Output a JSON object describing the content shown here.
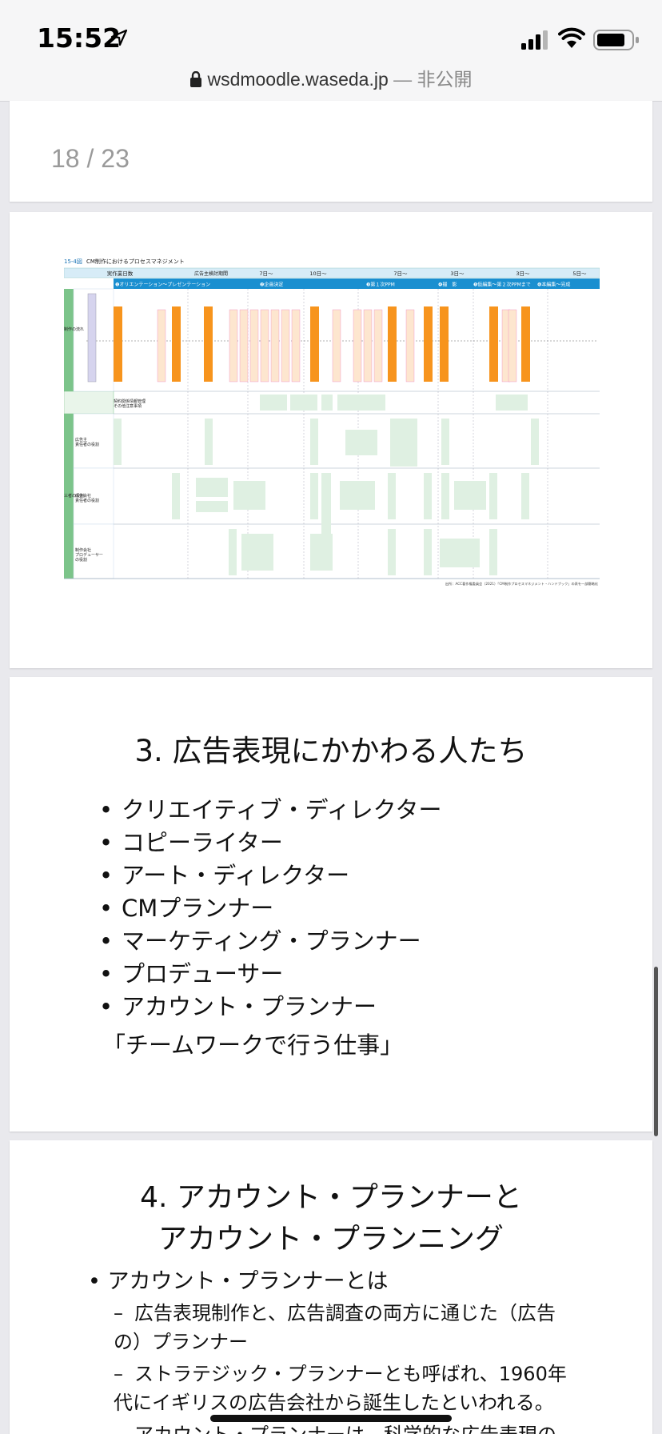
{
  "status": {
    "time": "15:52"
  },
  "address_bar": {
    "domain": "wsdmoodle.waseda.jp",
    "privacy": " — 非公開"
  },
  "page_counter": "18 / 23",
  "figure": {
    "label": "15-4図",
    "title": "CM制作におけるプロセスマネジメント",
    "headers": [
      "実作業日数",
      "広告主検討期間",
      "7日～",
      "10日～",
      "7日～",
      "3日～",
      "3日～",
      "5日～"
    ],
    "phases": [
      "❶オリエンテーション～プレゼンテーション",
      "❷企画決定",
      "❸第１次PPM",
      "❹撮　影",
      "❺仮編集～第２次PPMまで",
      "❻本編集～完成"
    ],
    "row_labels": [
      "契約関係情報管理\nその他注意事項",
      "広告主\n責任者の役割",
      "広告会社\n責任者の役割",
      "制作会社\nプロデューサー\nの役割"
    ],
    "side_labels": [
      "制作の流れ",
      "三者の役割"
    ],
    "source": "出所：ACC著作権委員会（2021）「CM制作プロセスマネジメント・ハンドブック」の表を一部簡略化"
  },
  "slide3": {
    "title": "3. 広告表現にかかわる人たち",
    "items": [
      "クリエイティブ・ディレクター",
      "コピーライター",
      "アート・ディレクター",
      "CMプランナー",
      "マーケティング・プランナー",
      "プロデューサー",
      "アカウント・プランナー"
    ],
    "tagline": "「チームワークで行う仕事」"
  },
  "slide4": {
    "title_line1": "4. アカウント・プランナーと",
    "title_line2": "アカウント・プランニング",
    "bullet": "アカウント・プランナーとは",
    "subs": [
      "広告表現制作と、広告調査の両方に通じた（広告の）プランナー",
      "ストラテジック・プランナーとも呼ばれ、1960年代にイギリスの広告会社から誕生したといわれる。",
      "アカウント・プランナーは、科学的な広告表現の"
    ]
  }
}
